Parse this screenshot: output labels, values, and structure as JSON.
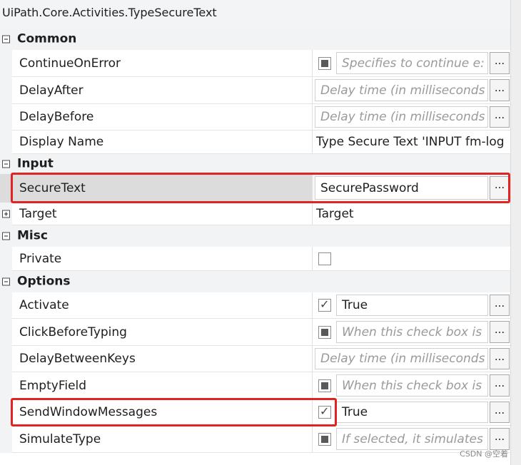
{
  "title": "UiPath.Core.Activities.TypeSecureText",
  "categories": {
    "common": "Common",
    "input": "Input",
    "misc": "Misc",
    "options": "Options"
  },
  "properties": {
    "continue_on_error": {
      "name": "ContinueOnError",
      "placeholder": "Specifies to continue e:"
    },
    "delay_after": {
      "name": "DelayAfter",
      "placeholder": "Delay time (in milliseconds"
    },
    "delay_before": {
      "name": "DelayBefore",
      "placeholder": "Delay time (in milliseconds"
    },
    "display_name": {
      "name": "Display Name",
      "value": "Type Secure Text 'INPUT  fm-log"
    },
    "secure_text": {
      "name": "SecureText",
      "value": "SecurePassword"
    },
    "target": {
      "name": "Target",
      "value": "Target"
    },
    "private": {
      "name": "Private"
    },
    "activate": {
      "name": "Activate",
      "value": "True"
    },
    "click_before_typing": {
      "name": "ClickBeforeTyping",
      "placeholder": "When this check box is"
    },
    "delay_between_keys": {
      "name": "DelayBetweenKeys",
      "placeholder": "Delay time (in milliseconds"
    },
    "empty_field": {
      "name": "EmptyField",
      "placeholder": "When this check box is"
    },
    "send_window_messages": {
      "name": "SendWindowMessages",
      "value": "True"
    },
    "simulate_type": {
      "name": "SimulateType",
      "placeholder": "If selected, it simulates"
    }
  },
  "ellipsis_label": "...",
  "watermark": "CSDN @空着",
  "colors": {
    "highlight": "#e02424",
    "category_bg": "#f2f3f5",
    "selected_row": "#dcdcdc"
  }
}
